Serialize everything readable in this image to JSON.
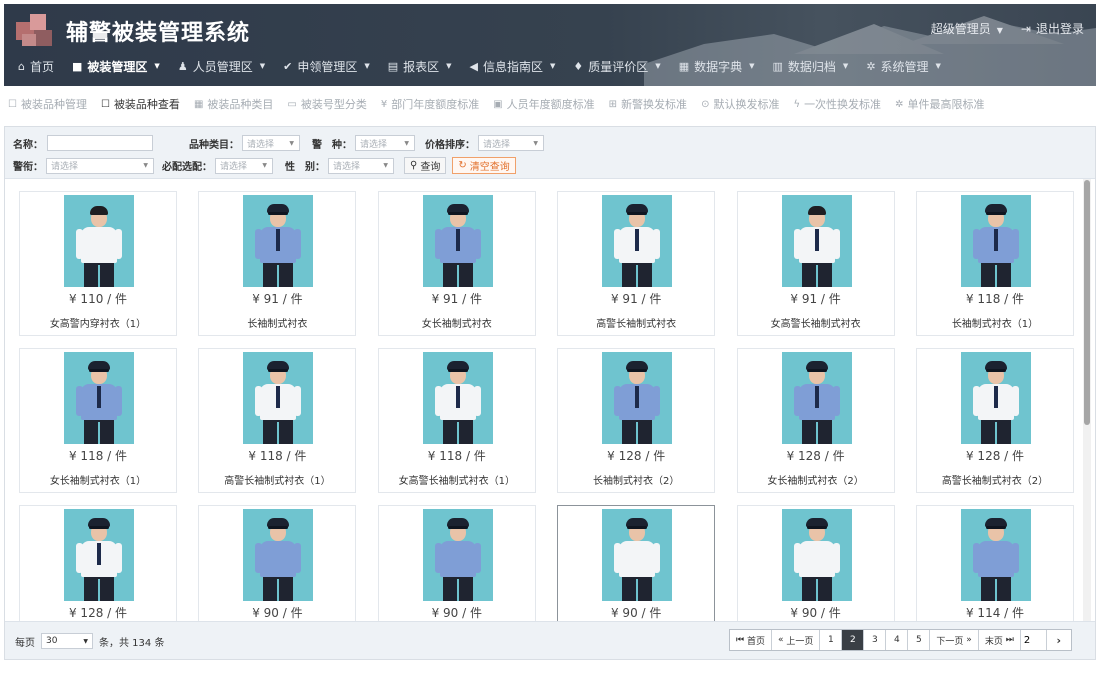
{
  "header": {
    "title": "辅警被装管理系统",
    "user": "超级管理员",
    "logout": "退出登录"
  },
  "topnav": [
    {
      "label": "首页",
      "icon": "home-icon",
      "glyph": "⌂",
      "dropdown": false
    },
    {
      "label": "被装管理区",
      "icon": "square-icon",
      "glyph": "■",
      "dropdown": true,
      "active": true
    },
    {
      "label": "人员管理区",
      "icon": "users-icon",
      "glyph": "♟",
      "dropdown": true
    },
    {
      "label": "申领管理区",
      "icon": "check-icon",
      "glyph": "✔",
      "dropdown": true
    },
    {
      "label": "报表区",
      "icon": "report-icon",
      "glyph": "▤",
      "dropdown": true
    },
    {
      "label": "信息指南区",
      "icon": "bullhorn-icon",
      "glyph": "◀",
      "dropdown": true
    },
    {
      "label": "质量评价区",
      "icon": "thumbs-up-icon",
      "glyph": "♦",
      "dropdown": true
    },
    {
      "label": "数据字典",
      "icon": "book-icon",
      "glyph": "▦",
      "dropdown": true
    },
    {
      "label": "数据归档",
      "icon": "database-icon",
      "glyph": "▥",
      "dropdown": true
    },
    {
      "label": "系统管理",
      "icon": "gear-icon",
      "glyph": "✲",
      "dropdown": true
    }
  ],
  "subnav": [
    {
      "label": "被装品种管理",
      "icon": "square-outline-icon",
      "glyph": "☐"
    },
    {
      "label": "被装品种查看",
      "icon": "square-outline-icon",
      "glyph": "☐",
      "active": true
    },
    {
      "label": "被装品种类目",
      "icon": "grid-icon",
      "glyph": "▦"
    },
    {
      "label": "被装号型分类",
      "icon": "folder-icon",
      "glyph": "▭"
    },
    {
      "label": "部门年度额度标准",
      "icon": "yen-icon",
      "glyph": "¥"
    },
    {
      "label": "人员年度额度标准",
      "icon": "id-card-icon",
      "glyph": "▣"
    },
    {
      "label": "新警换发标准",
      "icon": "plus-square-icon",
      "glyph": "⊞"
    },
    {
      "label": "默认换发标准",
      "icon": "circle-dot-icon",
      "glyph": "⊙"
    },
    {
      "label": "一次性换发标准",
      "icon": "bolt-icon",
      "glyph": "ϟ"
    },
    {
      "label": "单件最高限标准",
      "icon": "gear-icon",
      "glyph": "✲"
    }
  ],
  "filter": {
    "name_label": "名称：",
    "category_label": "品种类目：",
    "police_type_label": "警　种：",
    "price_sort_label": "价格排序：",
    "rank_label": "警衔：",
    "required_label": "必配选配：",
    "gender_label": "性　别：",
    "placeholder": "请选择",
    "query_button": "查询",
    "clear_button": "清空查询"
  },
  "products": [
    {
      "price": "¥ 110 / 件",
      "name": "女高警内穿衬衣（1）",
      "uniform": "white",
      "tie": false,
      "cap": false
    },
    {
      "price": "¥ 91 / 件",
      "name": "长袖制式衬衣",
      "uniform": "blue",
      "tie": true,
      "cap": true
    },
    {
      "price": "¥ 91 / 件",
      "name": "女长袖制式衬衣",
      "uniform": "blue",
      "tie": true,
      "cap": true
    },
    {
      "price": "¥ 91 / 件",
      "name": "高警长袖制式衬衣",
      "uniform": "white",
      "tie": true,
      "cap": true
    },
    {
      "price": "¥ 91 / 件",
      "name": "女高警长袖制式衬衣",
      "uniform": "white",
      "tie": true,
      "cap": false
    },
    {
      "price": "¥ 118 / 件",
      "name": "长袖制式衬衣（1）",
      "uniform": "blue",
      "tie": true,
      "cap": true
    },
    {
      "price": "¥ 118 / 件",
      "name": "女长袖制式衬衣（1）",
      "uniform": "blue",
      "tie": true,
      "cap": true
    },
    {
      "price": "¥ 118 / 件",
      "name": "高警长袖制式衬衣（1）",
      "uniform": "white",
      "tie": true,
      "cap": true
    },
    {
      "price": "¥ 118 / 件",
      "name": "女高警长袖制式衬衣（1）",
      "uniform": "white",
      "tie": true,
      "cap": true
    },
    {
      "price": "¥ 128 / 件",
      "name": "长袖制式衬衣（2）",
      "uniform": "blue",
      "tie": true,
      "cap": true
    },
    {
      "price": "¥ 128 / 件",
      "name": "女长袖制式衬衣（2）",
      "uniform": "blue",
      "tie": true,
      "cap": true
    },
    {
      "price": "¥ 128 / 件",
      "name": "高警长袖制式衬衣（2）",
      "uniform": "white",
      "tie": true,
      "cap": true
    },
    {
      "price": "¥ 128 / 件",
      "name": "",
      "uniform": "white",
      "tie": true,
      "cap": true
    },
    {
      "price": "¥ 90 / 件",
      "name": "",
      "uniform": "blue",
      "tie": false,
      "cap": true
    },
    {
      "price": "¥ 90 / 件",
      "name": "",
      "uniform": "blue",
      "tie": false,
      "cap": true
    },
    {
      "price": "¥ 90 / 件",
      "name": "",
      "uniform": "white",
      "tie": false,
      "cap": true,
      "selected": true
    },
    {
      "price": "¥ 90 / 件",
      "name": "",
      "uniform": "white",
      "tie": false,
      "cap": true
    },
    {
      "price": "¥ 114 / 件",
      "name": "",
      "uniform": "blue",
      "tie": false,
      "cap": true
    }
  ],
  "footer": {
    "per_page_label": "每页",
    "per_page_value": "30",
    "total_text": "条，共 134 条",
    "first": "首页",
    "prev": "上一页",
    "pages": [
      "1",
      "2",
      "3",
      "4",
      "5"
    ],
    "current_page": "2",
    "next": "下一页",
    "last": "末页",
    "goto_value": "2",
    "go": "›"
  },
  "colors": {
    "header_bg": "#36424f",
    "photo_bg": "#6fc4cf",
    "clear_button": "#e2702c",
    "active_page": "#3a3f45"
  }
}
